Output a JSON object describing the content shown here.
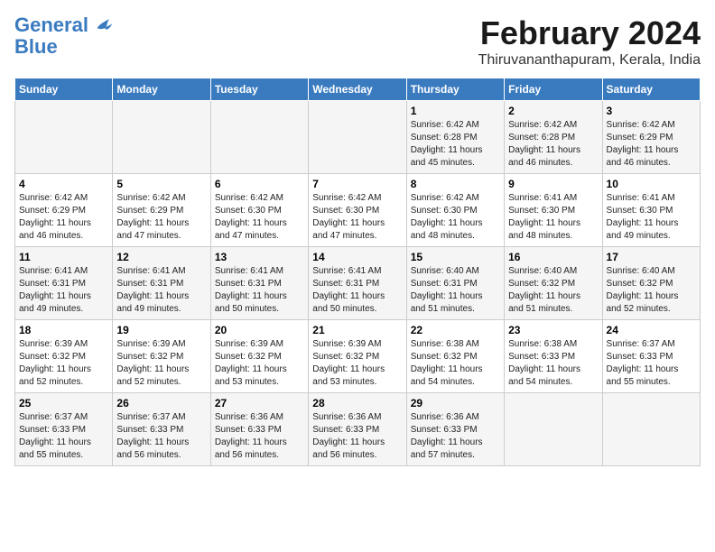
{
  "header": {
    "logo_line1": "General",
    "logo_line2": "Blue",
    "main_title": "February 2024",
    "subtitle": "Thiruvananthapuram, Kerala, India"
  },
  "days_of_week": [
    "Sunday",
    "Monday",
    "Tuesday",
    "Wednesday",
    "Thursday",
    "Friday",
    "Saturday"
  ],
  "weeks": [
    [
      {
        "day": "",
        "info": ""
      },
      {
        "day": "",
        "info": ""
      },
      {
        "day": "",
        "info": ""
      },
      {
        "day": "",
        "info": ""
      },
      {
        "day": "1",
        "info": "Sunrise: 6:42 AM\nSunset: 6:28 PM\nDaylight: 11 hours\nand 45 minutes."
      },
      {
        "day": "2",
        "info": "Sunrise: 6:42 AM\nSunset: 6:28 PM\nDaylight: 11 hours\nand 46 minutes."
      },
      {
        "day": "3",
        "info": "Sunrise: 6:42 AM\nSunset: 6:29 PM\nDaylight: 11 hours\nand 46 minutes."
      }
    ],
    [
      {
        "day": "4",
        "info": "Sunrise: 6:42 AM\nSunset: 6:29 PM\nDaylight: 11 hours\nand 46 minutes."
      },
      {
        "day": "5",
        "info": "Sunrise: 6:42 AM\nSunset: 6:29 PM\nDaylight: 11 hours\nand 47 minutes."
      },
      {
        "day": "6",
        "info": "Sunrise: 6:42 AM\nSunset: 6:30 PM\nDaylight: 11 hours\nand 47 minutes."
      },
      {
        "day": "7",
        "info": "Sunrise: 6:42 AM\nSunset: 6:30 PM\nDaylight: 11 hours\nand 47 minutes."
      },
      {
        "day": "8",
        "info": "Sunrise: 6:42 AM\nSunset: 6:30 PM\nDaylight: 11 hours\nand 48 minutes."
      },
      {
        "day": "9",
        "info": "Sunrise: 6:41 AM\nSunset: 6:30 PM\nDaylight: 11 hours\nand 48 minutes."
      },
      {
        "day": "10",
        "info": "Sunrise: 6:41 AM\nSunset: 6:30 PM\nDaylight: 11 hours\nand 49 minutes."
      }
    ],
    [
      {
        "day": "11",
        "info": "Sunrise: 6:41 AM\nSunset: 6:31 PM\nDaylight: 11 hours\nand 49 minutes."
      },
      {
        "day": "12",
        "info": "Sunrise: 6:41 AM\nSunset: 6:31 PM\nDaylight: 11 hours\nand 49 minutes."
      },
      {
        "day": "13",
        "info": "Sunrise: 6:41 AM\nSunset: 6:31 PM\nDaylight: 11 hours\nand 50 minutes."
      },
      {
        "day": "14",
        "info": "Sunrise: 6:41 AM\nSunset: 6:31 PM\nDaylight: 11 hours\nand 50 minutes."
      },
      {
        "day": "15",
        "info": "Sunrise: 6:40 AM\nSunset: 6:31 PM\nDaylight: 11 hours\nand 51 minutes."
      },
      {
        "day": "16",
        "info": "Sunrise: 6:40 AM\nSunset: 6:32 PM\nDaylight: 11 hours\nand 51 minutes."
      },
      {
        "day": "17",
        "info": "Sunrise: 6:40 AM\nSunset: 6:32 PM\nDaylight: 11 hours\nand 52 minutes."
      }
    ],
    [
      {
        "day": "18",
        "info": "Sunrise: 6:39 AM\nSunset: 6:32 PM\nDaylight: 11 hours\nand 52 minutes."
      },
      {
        "day": "19",
        "info": "Sunrise: 6:39 AM\nSunset: 6:32 PM\nDaylight: 11 hours\nand 52 minutes."
      },
      {
        "day": "20",
        "info": "Sunrise: 6:39 AM\nSunset: 6:32 PM\nDaylight: 11 hours\nand 53 minutes."
      },
      {
        "day": "21",
        "info": "Sunrise: 6:39 AM\nSunset: 6:32 PM\nDaylight: 11 hours\nand 53 minutes."
      },
      {
        "day": "22",
        "info": "Sunrise: 6:38 AM\nSunset: 6:32 PM\nDaylight: 11 hours\nand 54 minutes."
      },
      {
        "day": "23",
        "info": "Sunrise: 6:38 AM\nSunset: 6:33 PM\nDaylight: 11 hours\nand 54 minutes."
      },
      {
        "day": "24",
        "info": "Sunrise: 6:37 AM\nSunset: 6:33 PM\nDaylight: 11 hours\nand 55 minutes."
      }
    ],
    [
      {
        "day": "25",
        "info": "Sunrise: 6:37 AM\nSunset: 6:33 PM\nDaylight: 11 hours\nand 55 minutes."
      },
      {
        "day": "26",
        "info": "Sunrise: 6:37 AM\nSunset: 6:33 PM\nDaylight: 11 hours\nand 56 minutes."
      },
      {
        "day": "27",
        "info": "Sunrise: 6:36 AM\nSunset: 6:33 PM\nDaylight: 11 hours\nand 56 minutes."
      },
      {
        "day": "28",
        "info": "Sunrise: 6:36 AM\nSunset: 6:33 PM\nDaylight: 11 hours\nand 56 minutes."
      },
      {
        "day": "29",
        "info": "Sunrise: 6:36 AM\nSunset: 6:33 PM\nDaylight: 11 hours\nand 57 minutes."
      },
      {
        "day": "",
        "info": ""
      },
      {
        "day": "",
        "info": ""
      }
    ]
  ]
}
